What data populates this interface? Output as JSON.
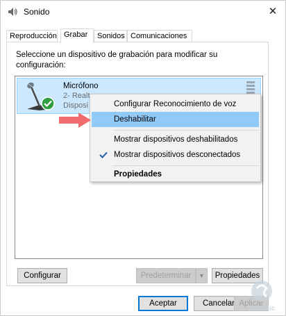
{
  "window": {
    "title": "Sonido",
    "close_glyph": "✕"
  },
  "tabs": [
    {
      "label": "Reproducción",
      "active": false
    },
    {
      "label": "Grabar",
      "active": true
    },
    {
      "label": "Sonidos",
      "active": false
    },
    {
      "label": "Comunicaciones",
      "active": false
    }
  ],
  "panel": {
    "instructions": "Seleccione un dispositivo de grabación para modificar su configuración:"
  },
  "device": {
    "name": "Micrófono",
    "line2": "2- Realt",
    "line3": "Disposi",
    "icon": "microphone-icon",
    "status_icon": "green-check-icon"
  },
  "context_menu": {
    "items": [
      {
        "label": "Configurar Reconocimiento de voz",
        "highlighted": false,
        "checked": false,
        "bold": false
      },
      {
        "label": "Deshabilitar",
        "highlighted": true,
        "checked": false,
        "bold": false
      },
      {
        "label": "Mostrar dispositivos deshabilitados",
        "highlighted": false,
        "checked": false,
        "bold": false
      },
      {
        "label": "Mostrar dispositivos desconectados",
        "highlighted": false,
        "checked": true,
        "bold": false
      },
      {
        "label": "Propiedades",
        "highlighted": false,
        "checked": false,
        "bold": true
      }
    ]
  },
  "buttons": {
    "configurar": "Configurar",
    "predeterminar": "Predeterminar",
    "propiedades": "Propiedades",
    "aceptar": "Aceptar",
    "cancelar": "Cancelar",
    "aplicar": "Aplicar"
  },
  "watermark": {
    "text": "Solvetic",
    "logo": "solvetic-logo"
  },
  "colors": {
    "selection": "#cce8ff",
    "menu_highlight": "#91c9f7",
    "arrow": "#f26d6d",
    "accent": "#0078d7",
    "check_green": "#2e9e3e"
  }
}
